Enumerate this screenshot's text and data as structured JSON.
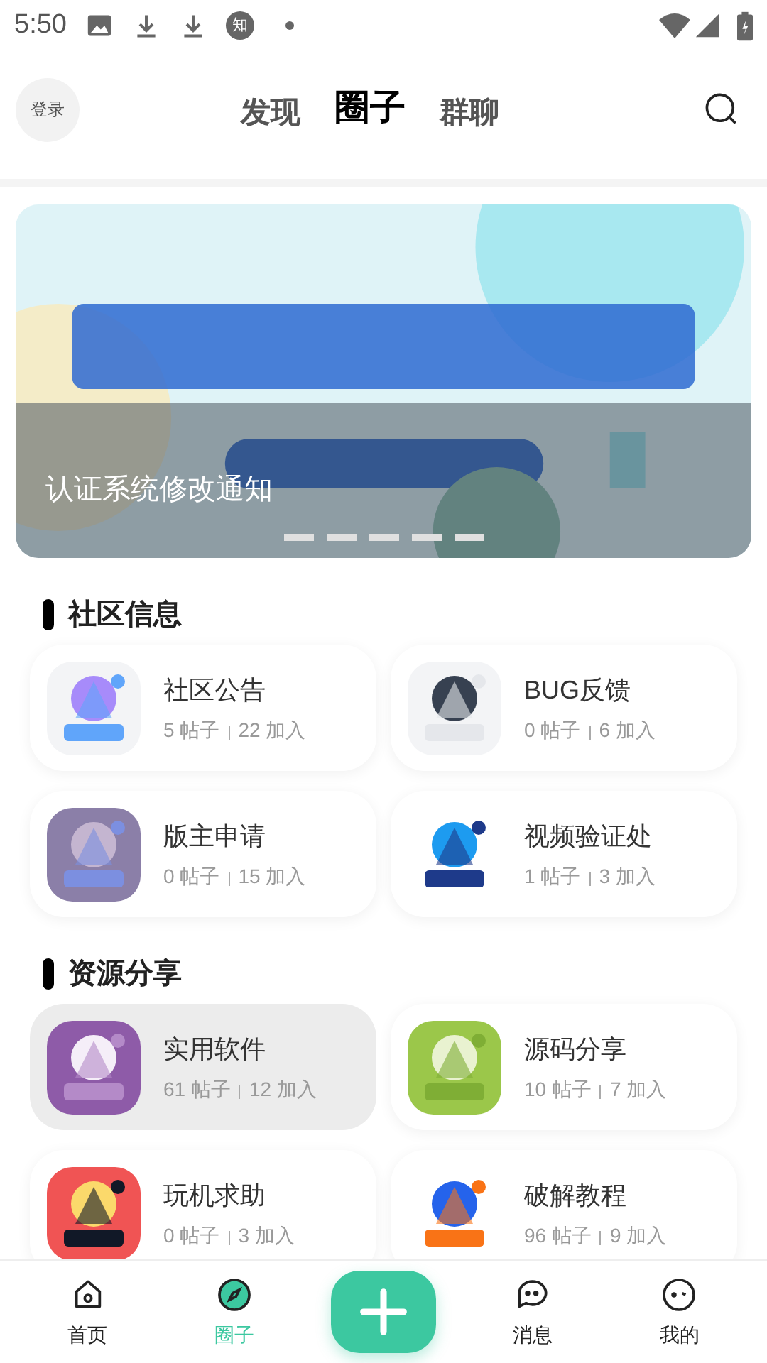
{
  "status_bar": {
    "time": "5:50",
    "badge": "知"
  },
  "header": {
    "login": "登录",
    "tabs": [
      {
        "label": "发现",
        "selected": false
      },
      {
        "label": "圈子",
        "selected": true
      },
      {
        "label": "群聊",
        "selected": false
      }
    ]
  },
  "banner": {
    "kind": "picture",
    "caption": "认证系统修改通知",
    "dots": [
      {
        "selected": false
      },
      {
        "selected": false
      },
      {
        "selected": false
      },
      {
        "selected": false
      },
      {
        "selected": false
      }
    ]
  },
  "sections": [
    {
      "title": "社区信息",
      "groups": [
        {
          "name": "社区公告",
          "posts": "5 帖子",
          "members": "22 加入",
          "pressed": false
        },
        {
          "name": "BUG反馈",
          "posts": "0 帖子",
          "members": "6 加入",
          "pressed": false
        },
        {
          "name": "版主申请",
          "posts": "0 帖子",
          "members": "15 加入",
          "pressed": false
        },
        {
          "name": "视频验证处",
          "posts": "1 帖子",
          "members": "3 加入",
          "pressed": false
        }
      ]
    },
    {
      "title": "资源分享",
      "groups": [
        {
          "name": "实用软件",
          "posts": "61 帖子",
          "members": "12 加入",
          "pressed": true
        },
        {
          "name": "源码分享",
          "posts": "10 帖子",
          "members": "7 加入",
          "pressed": false
        },
        {
          "name": "玩机求助",
          "posts": "0 帖子",
          "members": "3 加入",
          "pressed": false
        },
        {
          "name": "破解教程",
          "posts": "96 帖子",
          "members": "9 加入",
          "pressed": false
        }
      ]
    }
  ],
  "bottom_nav": [
    {
      "label": "首页",
      "kind": "home",
      "selected": false
    },
    {
      "label": "圈子",
      "kind": "compass",
      "selected": true
    },
    {
      "kind": "add"
    },
    {
      "label": "消息",
      "kind": "chat",
      "selected": false
    },
    {
      "label": "我的",
      "kind": "face",
      "selected": false
    }
  ]
}
